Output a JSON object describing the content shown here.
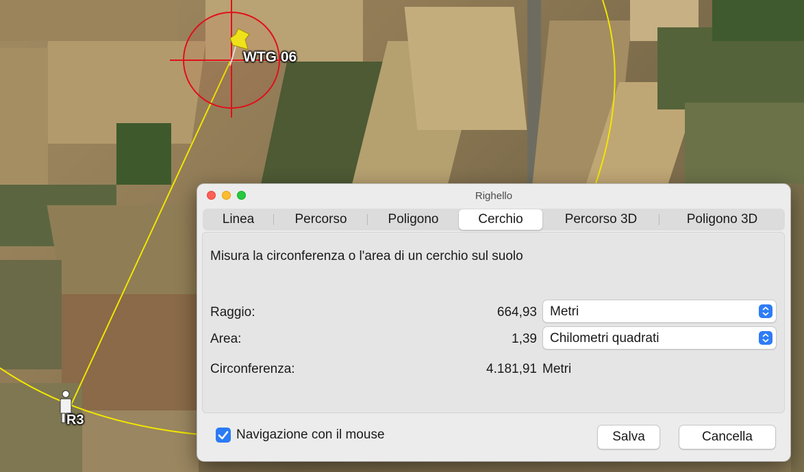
{
  "map": {
    "placemarks": [
      {
        "label": "WTG 06",
        "icon": "yellow-pushpin-icon"
      },
      {
        "label": "R3",
        "icon": "person-icon"
      }
    ],
    "colors": {
      "circle": "#e0101a",
      "path": "#f2e600"
    }
  },
  "dialog": {
    "title": "Righello",
    "tabs": [
      "Linea",
      "Percorso",
      "Poligono",
      "Cerchio",
      "Percorso 3D",
      "Poligono 3D"
    ],
    "active_tab": "Cerchio",
    "description": "Misura la circonferenza o l'area di un cerchio sul suolo",
    "rows": {
      "radius": {
        "label": "Raggio:",
        "value": "664,93",
        "unit": "Metri"
      },
      "area": {
        "label": "Area:",
        "value": "1,39",
        "unit": "Chilometri quadrati"
      },
      "circumference": {
        "label": "Circonferenza:",
        "value": "4.181,91",
        "unit": "Metri"
      }
    },
    "mouse_navigation": {
      "label": "Navigazione con il mouse",
      "checked": true
    },
    "buttons": {
      "save": "Salva",
      "cancel": "Cancella"
    },
    "colors": {
      "accent": "#2a7bf5"
    }
  }
}
